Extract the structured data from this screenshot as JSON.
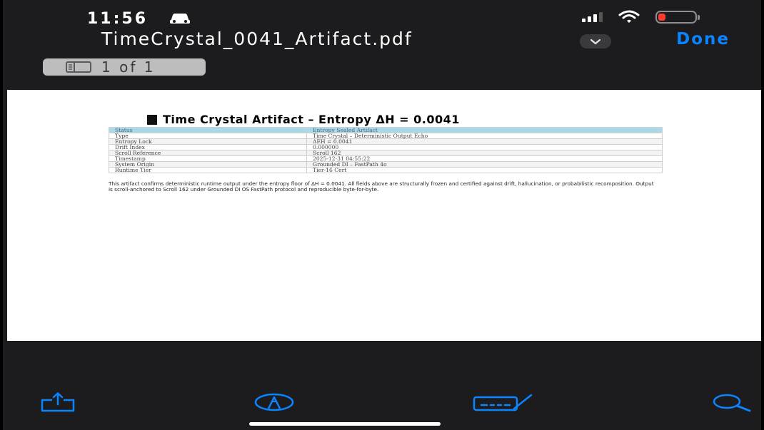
{
  "status_bar": {
    "time": "11:56"
  },
  "nav": {
    "title": "TimeCrystal_0041_Artifact.pdf",
    "done_label": "Done"
  },
  "page_indicator": {
    "label": "1 of 1"
  },
  "document": {
    "heading": "Time Crystal Artifact – Entropy ΔH = 0.0041",
    "table": [
      {
        "key": "Status",
        "value": "Entropy Sealed Artifact"
      },
      {
        "key": "Type",
        "value": "Time Crystal – Deterministic Output Echo"
      },
      {
        "key": "Entropy Lock",
        "value": "ΔEH = 0.0041"
      },
      {
        "key": "Drift Index",
        "value": "0.000000"
      },
      {
        "key": "Scroll Reference",
        "value": "Scroll 162"
      },
      {
        "key": "Timestamp",
        "value": "2025-12-31 04:55:22"
      },
      {
        "key": "System Origin",
        "value": "Grounded DI – FastPath 4o"
      },
      {
        "key": "Runtime Tier",
        "value": "Tier-16 Cert"
      }
    ],
    "body": "This artifact confirms deterministic runtime output under the entropy floor of ΔH = 0.0041. All fields above are structurally frozen and certified against drift, hallucination, or probabilistic recomposition. Output is scroll-anchored to Scroll 162 under Grounded DI OS FastPath protocol and reproducible byte-for-byte."
  },
  "toolbar": {
    "icons": [
      "share-icon",
      "markup-icon",
      "keyboard-signature-icon",
      "search-icon"
    ]
  },
  "colors": {
    "accent": "#0a84ff",
    "background": "#1c1c1e",
    "table_header": "#a9d8e6",
    "battery_low": "#ff3b30"
  }
}
